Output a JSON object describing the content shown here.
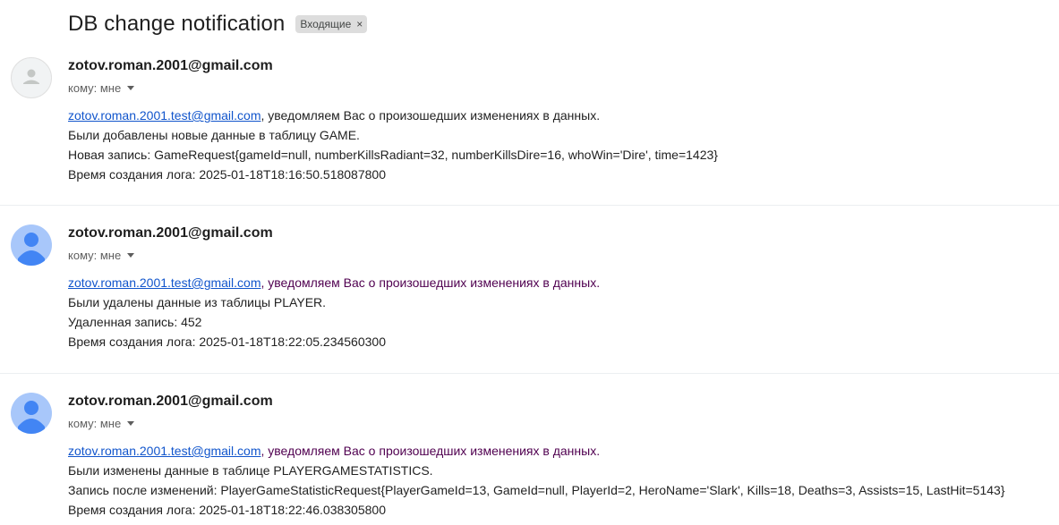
{
  "thread": {
    "subject": "DB change notification",
    "label": "Входящие",
    "label_remove": "×"
  },
  "messages": [
    {
      "avatar": "default-person-icon",
      "sender": "zotov.roman.2001@gmail.com",
      "recipient": "кому: мне",
      "link": "zotov.roman.2001.test@gmail.com",
      "greeting": ", уведомляем Вас о произошедших изменениях в данных.",
      "line2": "Были добавлены новые данные в таблицу GAME.",
      "line3": "Новая запись: GameRequest{gameId=null, numberKillsRadiant=32, numberKillsDire=16, whoWin='Dire', time=1423}",
      "line4": "Время создания лога: 2025-01-18T18:16:50.518087800"
    },
    {
      "avatar": "default-person-icon",
      "sender": "zotov.roman.2001@gmail.com",
      "recipient": "кому: мне",
      "link": "zotov.roman.2001.test@gmail.com",
      "greeting": ", уведомляем Вас о произошедших изменениях в данных.",
      "line2": "Были удалены данные из таблицы PLAYER.",
      "line3": "Удаленная запись: 452",
      "line4": "Время создания лога: 2025-01-18T18:22:05.234560300"
    },
    {
      "avatar": "default-person-icon",
      "sender": "zotov.roman.2001@gmail.com",
      "recipient": "кому: мне",
      "link": "zotov.roman.2001.test@gmail.com",
      "greeting": ", уведомляем Вас о произошедших изменениях в данных.",
      "line2": "Были изменены данные в таблице PLAYERGAMESTATISTICS.",
      "line3": "Запись после изменений: PlayerGameStatisticRequest{PlayerGameId=13, GameId=null, PlayerId=2, HeroName='Slark', Kills=18, Deaths=3, Assists=15, LastHit=5143}",
      "line4": "Время создания лога: 2025-01-18T18:22:46.038305800"
    }
  ],
  "colors": {
    "link": "#1155cc",
    "visited_text": "#500050",
    "avatar_blue": "#a8c7fa",
    "avatar_figure_blue": "#4285f4"
  }
}
